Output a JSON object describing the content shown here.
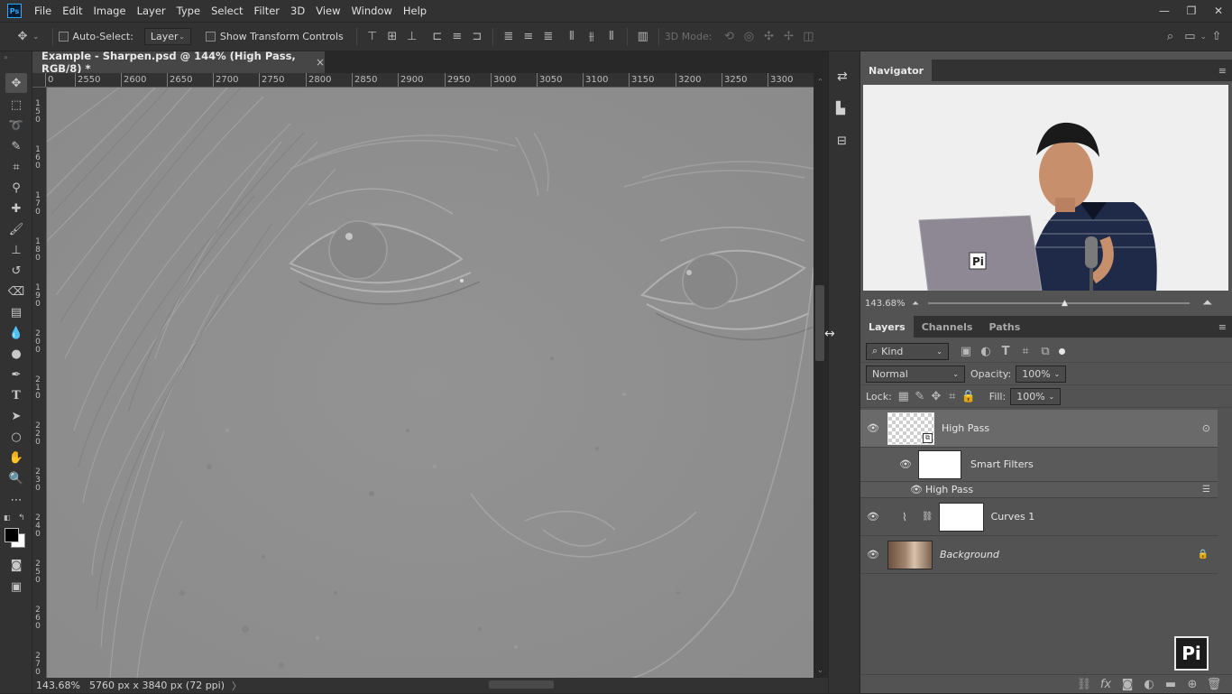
{
  "app": {
    "logo_text": "Ps"
  },
  "menu": [
    "File",
    "Edit",
    "Image",
    "Layer",
    "Type",
    "Select",
    "Filter",
    "3D",
    "View",
    "Window",
    "Help"
  ],
  "options": {
    "auto_select_label": "Auto-Select:",
    "auto_select_target": "Layer",
    "show_transform_label": "Show Transform Controls",
    "mode_3d_label": "3D Mode:"
  },
  "document": {
    "tab_title": "Example - Sharpen.psd @ 144% (High Pass, RGB/8) *",
    "tab_close": "×"
  },
  "rulers": {
    "horizontal": [
      "0",
      "2550",
      "2600",
      "2650",
      "2700",
      "2750",
      "2800",
      "2850",
      "2900",
      "2950",
      "3000",
      "3050",
      "3100",
      "3150",
      "3200",
      "3250",
      "3300"
    ],
    "vertical": [
      "1 5 0",
      "1 6 0",
      "1 7 0",
      "1 8 0",
      "1 9 0",
      "2 0 0",
      "2 1 0",
      "2 2 0",
      "2 3 0",
      "2 4 0",
      "2 5 0",
      "2 6 0",
      "2 7 0"
    ]
  },
  "status": {
    "zoom": "143.68%",
    "doc_info": "5760 px x 3840 px (72 ppi)",
    "arrow": "〉"
  },
  "navigator": {
    "tab": "Navigator",
    "zoom": "143.68%"
  },
  "layers_panel": {
    "tabs": [
      "Layers",
      "Channels",
      "Paths"
    ],
    "filter_kind": "Kind",
    "blend_mode": "Normal",
    "opacity_label": "Opacity:",
    "opacity_value": "100%",
    "lock_label": "Lock:",
    "fill_label": "Fill:",
    "fill_value": "100%",
    "layers": [
      {
        "name": "High Pass"
      },
      {
        "name": "Smart Filters"
      },
      {
        "name": "High Pass"
      },
      {
        "name": "Curves 1"
      },
      {
        "name": "Background"
      }
    ]
  },
  "watermark": {
    "text": "Pi"
  },
  "colors": {
    "accent": "#31a8ff",
    "panel_bg": "#535353",
    "chrome_bg": "#323232",
    "canvas_gray": "#8e8e8e"
  }
}
